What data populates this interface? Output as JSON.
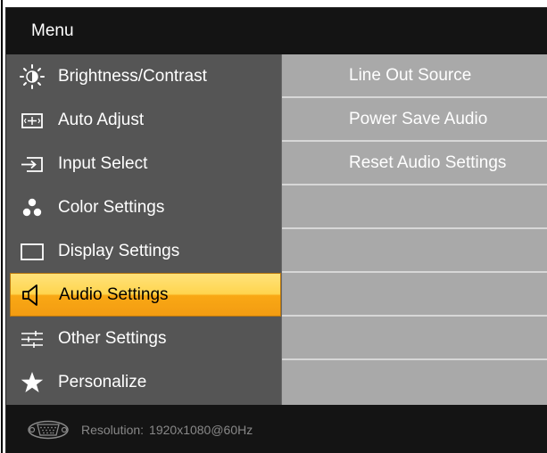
{
  "menu": {
    "title": "Menu",
    "items": [
      {
        "label": "Brightness/Contrast",
        "icon": "brightness-icon"
      },
      {
        "label": "Auto Adjust",
        "icon": "auto-adjust-icon"
      },
      {
        "label": "Input Select",
        "icon": "input-select-icon"
      },
      {
        "label": "Color Settings",
        "icon": "color-settings-icon"
      },
      {
        "label": "Display Settings",
        "icon": "display-settings-icon"
      },
      {
        "label": "Audio Settings",
        "icon": "speaker-icon",
        "selected": true
      },
      {
        "label": "Other Settings",
        "icon": "sliders-icon"
      },
      {
        "label": "Personalize",
        "icon": "star-icon"
      }
    ]
  },
  "submenu": {
    "items": [
      {
        "label": "Line Out Source"
      },
      {
        "label": "Power Save Audio"
      },
      {
        "label": "Reset Audio Settings"
      },
      {
        "label": ""
      },
      {
        "label": ""
      },
      {
        "label": ""
      },
      {
        "label": ""
      },
      {
        "label": ""
      }
    ]
  },
  "footer": {
    "resolution_label": "Resolution:",
    "resolution_value": "1920x1080@60Hz",
    "connector_icon": "vga-connector-icon"
  },
  "colors": {
    "selected_top": "#ffe27a",
    "selected_bottom": "#f39c12",
    "menu_bg": "#555555",
    "submenu_bg": "#a9a9a9",
    "frame_bg": "#141414"
  }
}
